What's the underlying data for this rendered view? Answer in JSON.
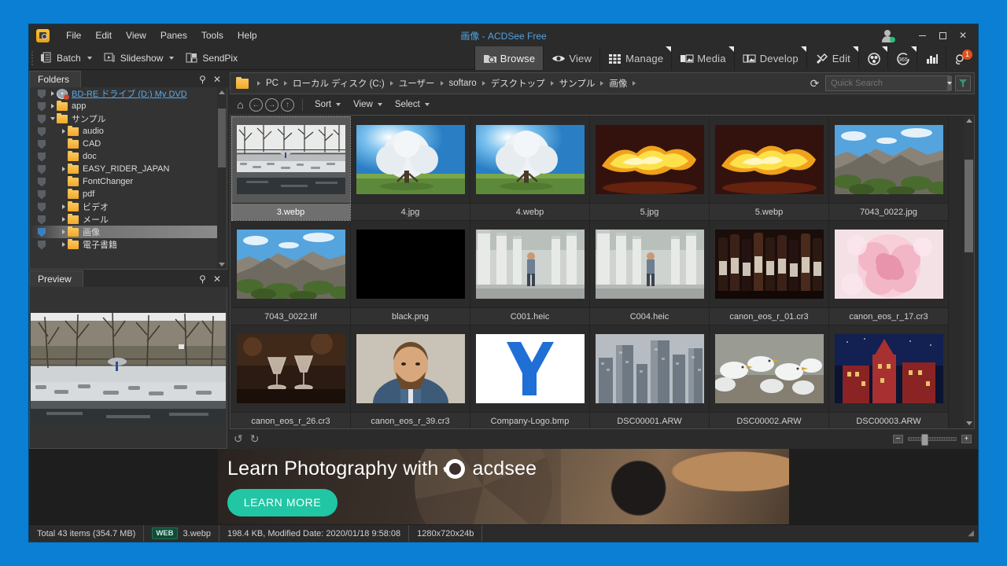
{
  "window": {
    "title_jp": "画像",
    "title_sub": " - ACDSee Free",
    "logo_icon": "acdsee-logo-icon",
    "minimize_label": "Minimize",
    "maximize_label": "Maximize",
    "close_label": "Close",
    "account_icon": "account-icon"
  },
  "menu": {
    "items": [
      "File",
      "Edit",
      "View",
      "Panes",
      "Tools",
      "Help"
    ]
  },
  "toolbar": {
    "items": [
      {
        "label": "Batch",
        "icon": "batch-icon",
        "dropdown": true
      },
      {
        "label": "Slideshow",
        "icon": "slideshow-icon",
        "dropdown": true
      },
      {
        "label": "SendPix",
        "icon": "sendpix-icon",
        "dropdown": false
      }
    ]
  },
  "modes": {
    "items": [
      {
        "label": "Browse",
        "icon": "browse-icon",
        "active": true,
        "corner": false
      },
      {
        "label": "View",
        "icon": "eye-icon",
        "active": false,
        "corner": false
      },
      {
        "label": "Manage",
        "icon": "grid-icon",
        "active": false,
        "corner": true
      },
      {
        "label": "Media",
        "icon": "media-icon",
        "active": false,
        "corner": true
      },
      {
        "label": "Develop",
        "icon": "develop-icon",
        "active": false,
        "corner": true
      },
      {
        "label": "Edit",
        "icon": "edit-icon",
        "active": false,
        "corner": true
      },
      {
        "label": "",
        "icon": "aperture-icon",
        "active": false,
        "corner": true
      },
      {
        "label": "",
        "icon": "365-icon",
        "active": false,
        "corner": true
      },
      {
        "label": "",
        "icon": "chart-icon",
        "active": false,
        "corner": false
      },
      {
        "label": "",
        "icon": "notifications-icon",
        "active": false,
        "corner": false,
        "badge": "1"
      }
    ]
  },
  "folders_panel": {
    "title": "Folders",
    "pin_icon": "pin-icon",
    "close_icon": "close-icon",
    "items": [
      {
        "label": "BD-RE ドライブ (D:) My DVD",
        "indent": 0,
        "icon": "disc-icon",
        "expander": "closed",
        "link": true
      },
      {
        "label": "app",
        "indent": 0,
        "icon": "folder-icon",
        "expander": "closed"
      },
      {
        "label": "サンプル",
        "indent": 0,
        "icon": "folder-icon",
        "expander": "open"
      },
      {
        "label": "audio",
        "indent": 1,
        "icon": "folder-icon",
        "expander": "closed"
      },
      {
        "label": "CAD",
        "indent": 1,
        "icon": "folder-icon",
        "expander": "none"
      },
      {
        "label": "doc",
        "indent": 1,
        "icon": "folder-icon",
        "expander": "none"
      },
      {
        "label": "EASY_RIDER_JAPAN",
        "indent": 1,
        "icon": "folder-icon",
        "expander": "closed"
      },
      {
        "label": "FontChanger",
        "indent": 1,
        "icon": "folder-icon",
        "expander": "none"
      },
      {
        "label": "pdf",
        "indent": 1,
        "icon": "folder-icon",
        "expander": "none"
      },
      {
        "label": "ビデオ",
        "indent": 1,
        "icon": "folder-icon",
        "expander": "closed"
      },
      {
        "label": "メール",
        "indent": 1,
        "icon": "folder-icon",
        "expander": "closed"
      },
      {
        "label": "画像",
        "indent": 1,
        "icon": "folder-icon",
        "expander": "closed",
        "selected": true
      },
      {
        "label": "電子書籍",
        "indent": 1,
        "icon": "folder-icon",
        "expander": "closed"
      }
    ]
  },
  "preview_panel": {
    "title": "Preview",
    "pin_icon": "pin-icon",
    "close_icon": "close-icon"
  },
  "breadcrumb": {
    "folder_icon": "folder-icon",
    "items": [
      "PC",
      "ローカル ディスク (C:)",
      "ユーザー",
      "softaro",
      "デスクトップ",
      "サンプル",
      "画像"
    ],
    "refresh_icon": "refresh-icon",
    "filter_icon": "filter-icon"
  },
  "search": {
    "placeholder": "Quick Search",
    "value": "",
    "dropdown_icon": "chevron-down-icon"
  },
  "navbar": {
    "home_icon": "home-icon",
    "back_icon": "back-icon",
    "forward_icon": "forward-icon",
    "up_icon": "up-icon",
    "menus": [
      "Sort",
      "View",
      "Select"
    ]
  },
  "grid": {
    "items": [
      {
        "name": "3.webp",
        "selected": true,
        "kind": "photo-winter"
      },
      {
        "name": "4.jpg",
        "selected": false,
        "kind": "photo-tree"
      },
      {
        "name": "4.webp",
        "selected": false,
        "kind": "photo-tree"
      },
      {
        "name": "5.jpg",
        "selected": false,
        "kind": "photo-fire"
      },
      {
        "name": "5.webp",
        "selected": false,
        "kind": "photo-fire"
      },
      {
        "name": "7043_0022.jpg",
        "selected": false,
        "kind": "photo-rock"
      },
      {
        "name": "7043_0022.tif",
        "selected": false,
        "kind": "photo-rock"
      },
      {
        "name": "black.png",
        "selected": false,
        "kind": "photo-black"
      },
      {
        "name": "C001.heic",
        "selected": false,
        "kind": "photo-colonnade"
      },
      {
        "name": "C004.heic",
        "selected": false,
        "kind": "photo-colonnade"
      },
      {
        "name": "canon_eos_r_01.cr3",
        "selected": false,
        "kind": "photo-wine"
      },
      {
        "name": "canon_eos_r_17.cr3",
        "selected": false,
        "kind": "photo-rose"
      },
      {
        "name": "canon_eos_r_26.cr3",
        "selected": false,
        "kind": "photo-glasses"
      },
      {
        "name": "canon_eos_r_39.cr3",
        "selected": false,
        "kind": "photo-portrait"
      },
      {
        "name": "Company-Logo.bmp",
        "selected": false,
        "kind": "logo"
      },
      {
        "name": "DSC00001.ARW",
        "selected": false,
        "kind": "photo-city"
      },
      {
        "name": "DSC00002.ARW",
        "selected": false,
        "kind": "photo-birds"
      },
      {
        "name": "DSC00003.ARW",
        "selected": false,
        "kind": "photo-night"
      }
    ]
  },
  "grid_footer": {
    "rotate_left_icon": "rotate-left-icon",
    "rotate_right_icon": "rotate-right-icon",
    "zoom_out_label": "−",
    "zoom_in_label": "+"
  },
  "ad": {
    "headline": "Learn Photography with",
    "brand": "acdsee",
    "button_label": "LEARN MORE",
    "accent_color": "#21c6a4"
  },
  "status": {
    "total": "Total 43 items  (354.7 MB)",
    "format_badge": "WEB",
    "filename": "3.webp",
    "fileinfo": "198.4 KB, Modified Date: 2020/01/18 9:58:08",
    "dimensions": "1280x720x24b"
  }
}
